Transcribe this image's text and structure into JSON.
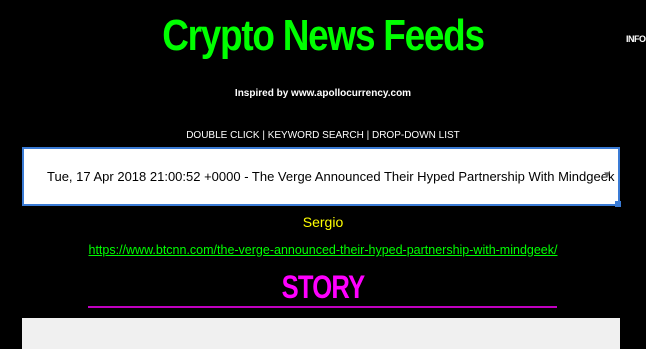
{
  "header": {
    "title": "Crypto News Feeds",
    "info_label": "INFO",
    "subtitle": "Inspired by www.apollocurrency.com",
    "instructions": "DOUBLE CLICK | KEYWORD SEARCH | DROP-DOWN LIST"
  },
  "feed_select": {
    "selected_value": "Tue, 17 Apr 2018 21:00:52 +0000 - The Verge Announced Their Hyped Partnership With Mindgeek",
    "arrow_glyph": "▼"
  },
  "article": {
    "author": "Sergio",
    "link": "https://www.btcnn.com/the-verge-announced-their-hyped-partnership-with-mindgeek/",
    "story_heading": "STORY",
    "story_text": ""
  },
  "colors": {
    "background": "#000000",
    "title": "#00ff00",
    "author": "#ffff00",
    "story_heading": "#ff00ff",
    "select_border": "#3a7bd5",
    "story_panel": "#f0f0f0"
  }
}
